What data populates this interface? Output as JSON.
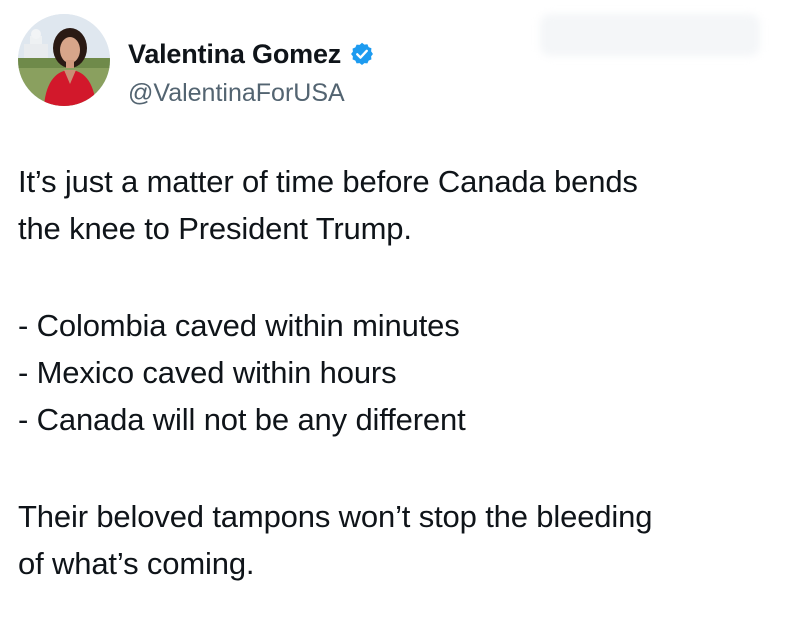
{
  "author": {
    "display_name": "Valentina Gomez",
    "handle": "@ValentinaForUSA",
    "verified": true,
    "verified_color": "#1d9bf0"
  },
  "tweet": {
    "intro_lines": [
      "It’s just a matter of time before Canada bends",
      "the knee to President Trump."
    ],
    "bullets": [
      "- Colombia caved within minutes",
      "- Mexico caved within hours",
      "- Canada will not be any different"
    ],
    "closing_lines": [
      "Their beloved tampons won’t stop the bleeding",
      "of what’s coming."
    ]
  },
  "icons": {
    "verified": "verified-badge-icon",
    "avatar": "profile-photo"
  },
  "colors": {
    "text": "#0f1419",
    "secondary_text": "#536471",
    "background": "#ffffff"
  }
}
